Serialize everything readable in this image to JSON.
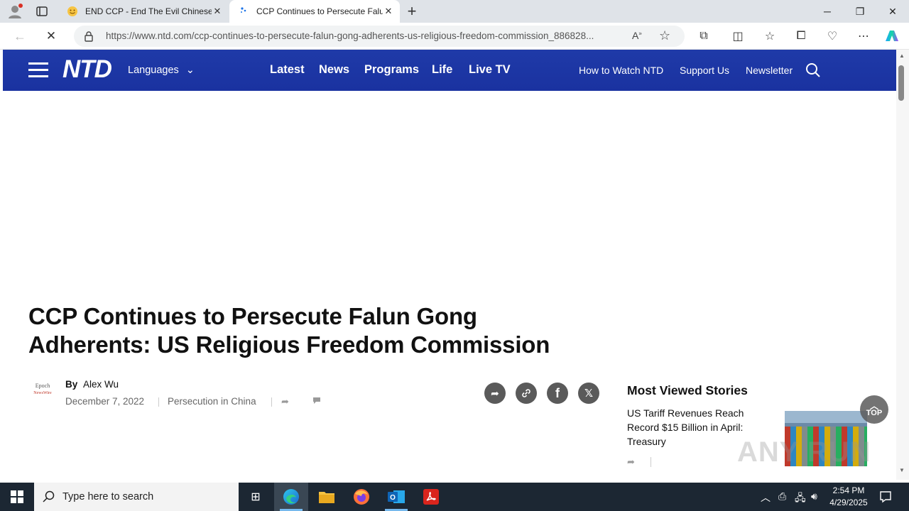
{
  "browser": {
    "tabs": [
      {
        "title": "END CCP - End The Evil Chinese"
      },
      {
        "title": "CCP Continues to Persecute Falu"
      }
    ],
    "url": "https://www.ntd.com/ccp-continues-to-persecute-falun-gong-adherents-us-religious-freedom-commission_886828...",
    "accent": "#1a32a0"
  },
  "site": {
    "logo": "NTD",
    "languages_label": "Languages",
    "main_nav": [
      "Latest",
      "News",
      "Programs",
      "Life",
      "Live TV"
    ],
    "secondary_nav": [
      "How to Watch NTD",
      "Support Us",
      "Newsletter"
    ]
  },
  "article": {
    "headline_line1": "CCP Continues to Persecute Falun Gong",
    "headline_line2": "Adherents: US Religious Freedom Commission",
    "author_logo_line1": "Epoch",
    "author_logo_line2": "NewsWire",
    "by_label": "By",
    "author": "Alex Wu",
    "date": "December 7, 2022",
    "category": "Persecution in China"
  },
  "sidebar": {
    "title": "Most Viewed Stories",
    "story": "US Tariff Revenues Reach Record $15 Billion in April: Treasury",
    "top_label": "TOP"
  },
  "watermark": "ANY RUN",
  "taskbar": {
    "search_placeholder": "Type here to search",
    "time": "2:54 PM",
    "date": "4/29/2025"
  }
}
